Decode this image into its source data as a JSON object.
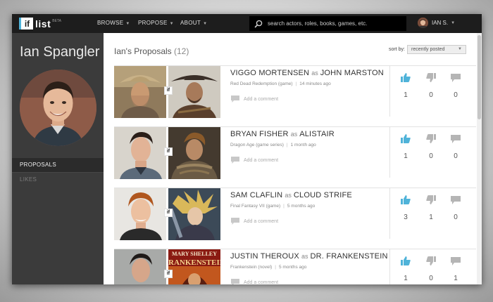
{
  "app": {
    "logo_mark": "if",
    "logo_word": "list",
    "logo_badge": "BETA"
  },
  "nav": {
    "items": [
      {
        "label": "BROWSE"
      },
      {
        "label": "PROPOSE"
      },
      {
        "label": "ABOUT"
      }
    ],
    "search_placeholder": "search actors, roles, books, games, etc.",
    "user_label": "IAN S."
  },
  "profile": {
    "name": "Ian Spangler",
    "sidebar_items": [
      {
        "label": "PROPOSALS",
        "active": true
      },
      {
        "label": "LIKES",
        "active": false
      }
    ]
  },
  "main": {
    "title": "Ian's Proposals",
    "count": "(12)",
    "sort_label": "sort by:",
    "sort_value": "recently posted",
    "add_comment_label": "Add a comment",
    "as_label": "as",
    "proposals": [
      {
        "actor": "VIGGO MORTENSEN",
        "role": "JOHN MARSTON",
        "source": "Red Dead Redemption (game)",
        "time": "14 minutes ago",
        "likes": "1",
        "dislikes": "0",
        "comments": "0"
      },
      {
        "actor": "BRYAN FISHER",
        "role": "ALISTAIR",
        "source": "Dragon Age (game series)",
        "time": "1 month ago",
        "likes": "1",
        "dislikes": "0",
        "comments": "0"
      },
      {
        "actor": "SAM CLAFLIN",
        "role": "CLOUD STRIFE",
        "source": "Final Fantasy VII (game)",
        "time": "5 months ago",
        "likes": "3",
        "dislikes": "1",
        "comments": "0"
      },
      {
        "actor": "JUSTIN THEROUX",
        "role": "DR. FRANKENSTEIN",
        "source": "Frankenstein (novel)",
        "time": "5 months ago",
        "likes": "1",
        "dislikes": "0",
        "comments": "1"
      }
    ],
    "book_cover": {
      "line1": "MARY SHELLEY",
      "line2": "FRANKENSTEIN"
    }
  },
  "colors": {
    "accent": "#4fb3d9",
    "topbar": "#1d1d1d",
    "sidebar": "#3b3b3b",
    "icon_gray": "#b5b5b5"
  },
  "icons": {
    "search": "search-icon",
    "like": "thumbs-up-icon",
    "dislike": "thumbs-down-icon",
    "comment": "speech-bubble-icon"
  }
}
